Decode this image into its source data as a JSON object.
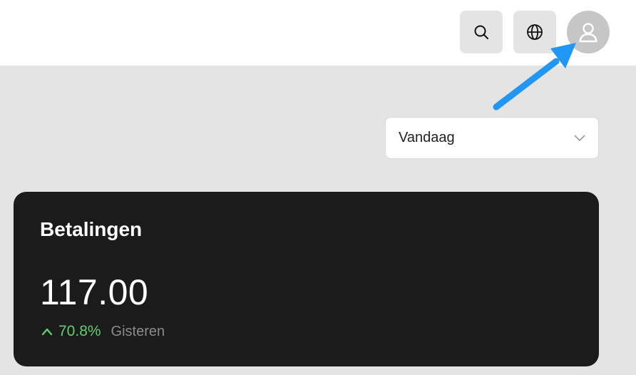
{
  "header": {
    "icons": {
      "search": "search-icon",
      "language": "globe-icon",
      "account": "user-icon"
    }
  },
  "filter": {
    "selected": "Vandaag"
  },
  "card": {
    "title": "Betalingen",
    "value": "117.00",
    "change_percent": "70.8%",
    "comparison_label": "Gisteren"
  },
  "colors": {
    "page_background": "#e4e4e4",
    "card_background": "#1b1b1b",
    "positive": "#5ed16a",
    "annotation_arrow": "#2196f3",
    "avatar_background": "#c6c6c6"
  }
}
